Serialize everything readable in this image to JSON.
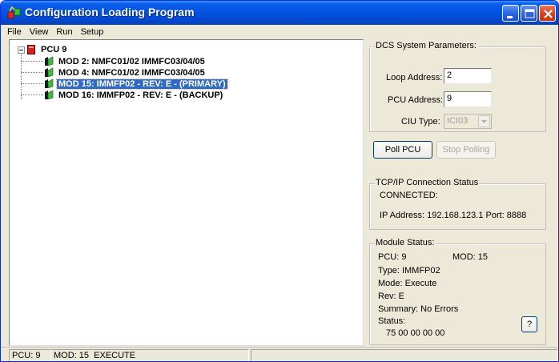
{
  "window": {
    "title": "Configuration Loading Program"
  },
  "menu": [
    "File",
    "View",
    "Run",
    "Setup"
  ],
  "tree": {
    "root_label": "PCU 9",
    "nodes": [
      {
        "label": "MOD 2: NMFC01/02 IMMFC03/04/05",
        "selected": false
      },
      {
        "label": "MOD 4: NMFC01/02 IMMFC03/04/05",
        "selected": false
      },
      {
        "label": "MOD 15: IMMFP02 - REV: E - (PRIMARY)",
        "selected": true
      },
      {
        "label": "MOD 16: IMMFP02 - REV: E - (BACKUP)",
        "selected": false
      }
    ]
  },
  "dcs": {
    "title": "DCS System Parameters:",
    "loop_label": "Loop Address:",
    "loop_value": "2",
    "pcu_label": "PCU Address:",
    "pcu_value": "9",
    "ciu_label": "CIU Type:",
    "ciu_value": "ICI03"
  },
  "buttons": {
    "poll": "Poll PCU",
    "stop": "Stop Polling",
    "help": "?"
  },
  "tcp": {
    "title": "TCP/IP Connection Status",
    "state": "CONNECTED:",
    "address_line": "IP Address: 192.168.123.1  Port: 8888"
  },
  "module": {
    "title": "Module Status:",
    "pcu": "PCU:  9",
    "mod": "MOD:  15",
    "type": "Type:  IMMFP02",
    "mode": "Mode:  Execute",
    "rev": "Rev:  E",
    "summary": "Summary:   No Errors",
    "status_label": "Status:",
    "status_value": "75 00 00 00 00"
  },
  "statusbar": {
    "pcu": "PCU: 9",
    "mod": "MOD: 15",
    "state": "EXECUTE"
  },
  "colors": {
    "titlebar": "#0054e3",
    "selection": "#316ac5",
    "window_bg": "#ece9d8"
  }
}
